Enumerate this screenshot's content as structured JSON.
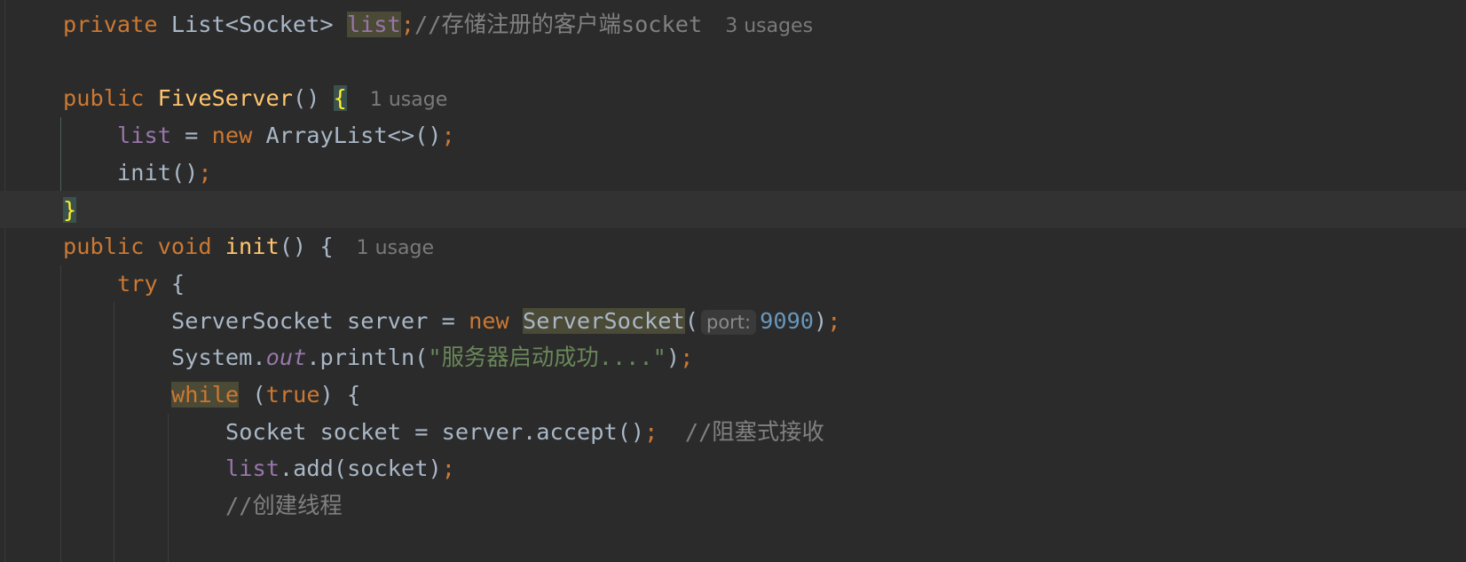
{
  "theme": {
    "background": "#2b2b2b",
    "keyword": "#cc7832",
    "field": "#9876aa",
    "method": "#ffc66d",
    "string": "#6a8759",
    "number": "#6897bb",
    "comment": "#808080",
    "text": "#a9b7c6"
  },
  "lines": [
    {
      "indent": 0,
      "tokens": [
        {
          "t": "private ",
          "c": "kw"
        },
        {
          "t": "List<Socket> "
        },
        {
          "t": "list",
          "c": "field hl"
        },
        {
          "t": ";",
          "c": "semi"
        },
        {
          "t": "//存储注册的客户端socket",
          "c": "cmt"
        }
      ],
      "usage": "3 usages"
    },
    {
      "indent": 0,
      "tokens": []
    },
    {
      "indent": 0,
      "tokens": [
        {
          "t": "public ",
          "c": "kw"
        },
        {
          "t": "FiveServer",
          "c": "fn"
        },
        {
          "t": "() "
        },
        {
          "t": "{",
          "c": "brace"
        }
      ],
      "usage": "1 usage"
    },
    {
      "indent": 1,
      "tokens": [
        {
          "t": "list",
          "c": "field"
        },
        {
          "t": " = "
        },
        {
          "t": "new ",
          "c": "kw"
        },
        {
          "t": "ArrayList<>()"
        },
        {
          "t": ";",
          "c": "semi"
        }
      ]
    },
    {
      "indent": 1,
      "tokens": [
        {
          "t": "init()"
        },
        {
          "t": ";",
          "c": "semi"
        }
      ]
    },
    {
      "indent": 0,
      "tokens": [
        {
          "t": "}",
          "c": "brace"
        }
      ]
    },
    {
      "indent": 0,
      "tokens": [
        {
          "t": "public ",
          "c": "kw"
        },
        {
          "t": "void ",
          "c": "kw"
        },
        {
          "t": "init",
          "c": "fn"
        },
        {
          "t": "() {"
        }
      ],
      "usage": "1 usage"
    },
    {
      "indent": 1,
      "tokens": [
        {
          "t": "try ",
          "c": "kw"
        },
        {
          "t": "{"
        }
      ]
    },
    {
      "indent": 2,
      "tokens": [
        {
          "t": "ServerSocket server = "
        },
        {
          "t": "new ",
          "c": "kw"
        },
        {
          "t": "ServerSocket",
          "c": "hl"
        },
        {
          "t": "("
        },
        {
          "t": "port:",
          "c": "hint"
        },
        {
          "t": "9090",
          "c": "num"
        },
        {
          "t": ")"
        },
        {
          "t": ";",
          "c": "semi"
        }
      ]
    },
    {
      "indent": 2,
      "tokens": [
        {
          "t": "System."
        },
        {
          "t": "out",
          "c": "static"
        },
        {
          "t": ".println("
        },
        {
          "t": "\"服务器启动成功....\"",
          "c": "str"
        },
        {
          "t": ")"
        },
        {
          "t": ";",
          "c": "semi"
        }
      ]
    },
    {
      "indent": 2,
      "tokens": [
        {
          "t": "while",
          "c": "kw hl"
        },
        {
          "t": " ("
        },
        {
          "t": "true",
          "c": "kw"
        },
        {
          "t": ") {"
        }
      ]
    },
    {
      "indent": 3,
      "tokens": [
        {
          "t": "Socket socket = server.accept()"
        },
        {
          "t": ";",
          "c": "semi"
        },
        {
          "t": "  //阻塞式接收",
          "c": "cmt"
        }
      ]
    },
    {
      "indent": 3,
      "tokens": [
        {
          "t": "list",
          "c": "field"
        },
        {
          "t": ".add(socket)"
        },
        {
          "t": ";",
          "c": "semi"
        }
      ]
    },
    {
      "indent": 3,
      "tokens": [
        {
          "t": "//创建线程",
          "c": "cmt"
        }
      ]
    }
  ]
}
